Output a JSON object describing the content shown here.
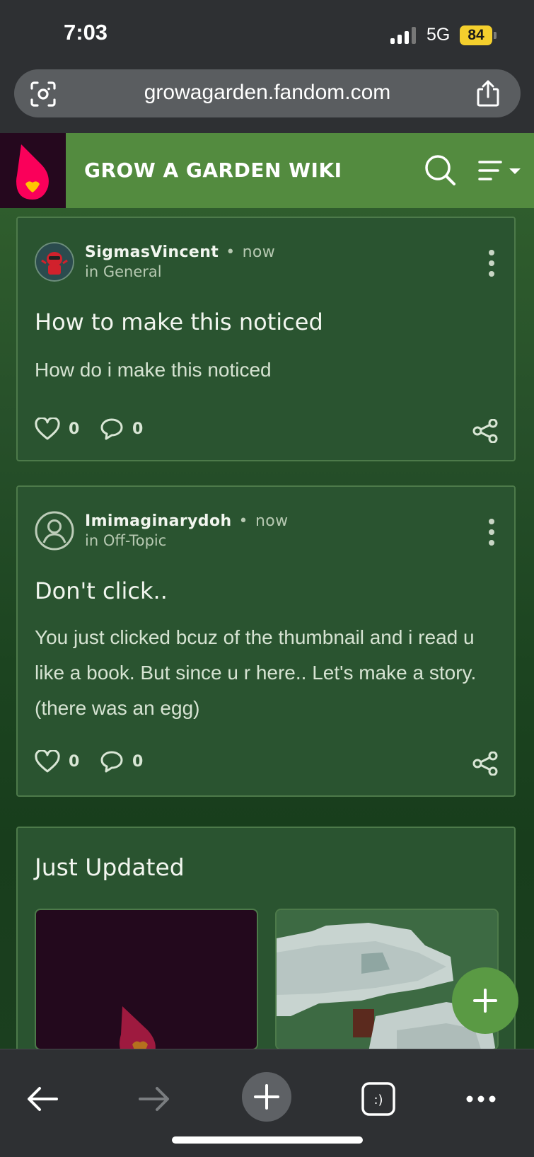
{
  "status_bar": {
    "time": "7:03",
    "network": "5G",
    "battery": "84"
  },
  "browser": {
    "url": "growagarden.fandom.com"
  },
  "wiki": {
    "title": "GROW A GARDEN WIKI"
  },
  "posts": [
    {
      "author": "SigmasVincent",
      "time": "now",
      "category": "in General",
      "title": "How to make this noticed",
      "body": "How do i make this noticed",
      "likes": "0",
      "comments": "0"
    },
    {
      "author": "Imimaginarydoh",
      "time": "now",
      "category": "in Off-Topic",
      "title": "Don't click..",
      "body": "You just clicked bcuz of the thumbnail and i read u like a book. But since u r here.. Let's make a story. (there was an egg)",
      "likes": "0",
      "comments": "0"
    }
  ],
  "just_updated": {
    "title": "Just Updated"
  },
  "colors": {
    "brand_green": "#538b3f",
    "fandom_dark": "#25081e",
    "card_bg": "#2a5430"
  },
  "icons": [
    "camera-icon",
    "share-icon",
    "fandom-logo",
    "search-icon",
    "menu-icon",
    "heart-icon",
    "comment-icon",
    "kebab-icon",
    "plus-icon",
    "back-icon",
    "forward-icon",
    "tabs-icon",
    "more-icon"
  ]
}
